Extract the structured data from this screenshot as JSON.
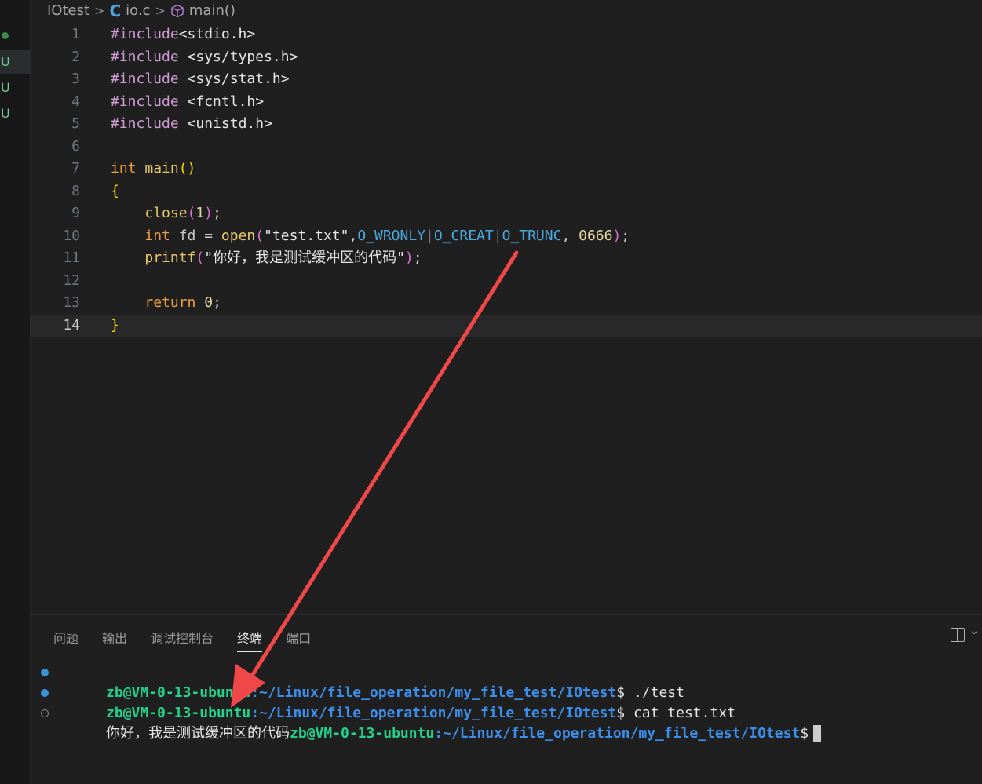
{
  "breadcrumb": {
    "folder": "IOtest",
    "file": "io.c",
    "symbol": "main()"
  },
  "gutter": {
    "marks": [
      "U",
      "U",
      "U"
    ]
  },
  "code": {
    "lines": [
      {
        "n": "1",
        "parts": [
          [
            "c-inc",
            "#include"
          ],
          [
            "c-inc-path",
            "<stdio.h>"
          ]
        ]
      },
      {
        "n": "2",
        "parts": [
          [
            "c-inc",
            "#include "
          ],
          [
            "c-inc-path",
            "<sys/types.h>"
          ]
        ]
      },
      {
        "n": "3",
        "parts": [
          [
            "c-inc",
            "#include "
          ],
          [
            "c-inc-path",
            "<sys/stat.h>"
          ]
        ]
      },
      {
        "n": "4",
        "parts": [
          [
            "c-inc",
            "#include "
          ],
          [
            "c-inc-path",
            "<fcntl.h>"
          ]
        ]
      },
      {
        "n": "5",
        "parts": [
          [
            "c-inc",
            "#include "
          ],
          [
            "c-inc-path",
            "<unistd.h>"
          ]
        ]
      },
      {
        "n": "6",
        "parts": []
      },
      {
        "n": "7",
        "parts": [
          [
            "c-type",
            "int "
          ],
          [
            "c-fn",
            "main"
          ],
          [
            "c-brace",
            "()"
          ]
        ]
      },
      {
        "n": "8",
        "parts": [
          [
            "c-brace",
            "{"
          ]
        ]
      },
      {
        "n": "9",
        "parts": [
          [
            "punc",
            "    "
          ],
          [
            "c-fn",
            "close"
          ],
          [
            "c-paren",
            "("
          ],
          [
            "c-num",
            "1"
          ],
          [
            "c-paren",
            ")"
          ],
          [
            "punc",
            ";"
          ]
        ]
      },
      {
        "n": "10",
        "parts": [
          [
            "punc",
            "    "
          ],
          [
            "c-type",
            "int "
          ],
          [
            "punc",
            "fd = "
          ],
          [
            "c-fn",
            "open"
          ],
          [
            "c-paren",
            "("
          ],
          [
            "c-str",
            "\"test.txt\""
          ],
          [
            "punc",
            ","
          ],
          [
            "c-mac",
            "O_WRONLY"
          ],
          [
            "c-bar",
            "|"
          ],
          [
            "c-mac",
            "O_CREAT"
          ],
          [
            "c-bar",
            "|"
          ],
          [
            "c-mac",
            "O_TRUNC"
          ],
          [
            "punc",
            ", "
          ],
          [
            "c-num",
            "0666"
          ],
          [
            "c-paren",
            ")"
          ],
          [
            "punc",
            ";"
          ]
        ]
      },
      {
        "n": "11",
        "parts": [
          [
            "punc",
            "    "
          ],
          [
            "c-fn",
            "printf"
          ],
          [
            "c-paren",
            "("
          ],
          [
            "c-str",
            "\"你好，我是测试缓冲区的代码\""
          ],
          [
            "c-paren",
            ")"
          ],
          [
            "punc",
            ";"
          ]
        ]
      },
      {
        "n": "12",
        "parts": []
      },
      {
        "n": "13",
        "parts": [
          [
            "punc",
            "    "
          ],
          [
            "c-kw",
            "return "
          ],
          [
            "c-num",
            "0"
          ],
          [
            "punc",
            ";"
          ]
        ]
      },
      {
        "n": "14",
        "parts": [
          [
            "c-brace",
            "}"
          ]
        ]
      }
    ]
  },
  "panel": {
    "tabs": [
      "问题",
      "输出",
      "调试控制台",
      "终端",
      "端口"
    ],
    "active_tab": 3
  },
  "terminal": {
    "user": "zb@VM-0-13-ubuntu",
    "path": ":~/Linux/file_operation/my_file_test/IOtest",
    "prompt_symbol": "$",
    "cmd1": " ./test",
    "cmd2": " cat test.txt",
    "output": "你好，我是测试缓冲区的代码"
  },
  "colors": {
    "arrow": "#f04848",
    "accent": "#3794d6"
  }
}
